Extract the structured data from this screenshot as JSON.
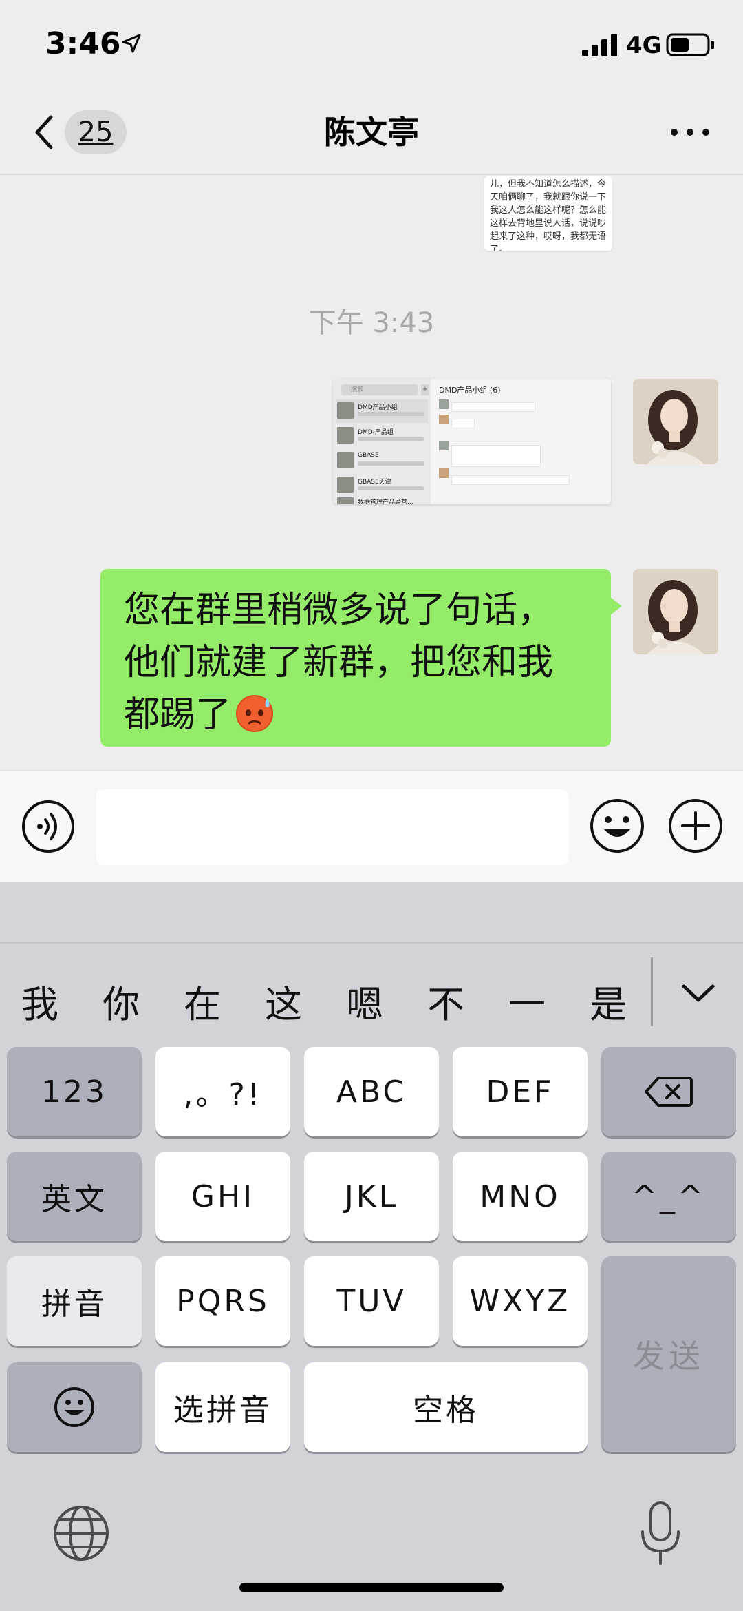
{
  "status_bar": {
    "time": "3:46",
    "network": "4G",
    "location_icon": "location-arrow-icon",
    "signal_icon": "signal-bars-icon",
    "battery_icon": "battery-icon"
  },
  "nav": {
    "back_icon": "chevron-left-icon",
    "unread_count": "25",
    "title": "陈文亭",
    "more_icon": "ellipsis-icon"
  },
  "chat": {
    "prev_image_text": "儿，但我不知道怎么描述，今天咱俩聊了，我就跟你说一下我这人怎么能这样呢？怎么能这样去背地里说人话，说说吵起来了这种，哎呀，我都无语了。",
    "timestamp": "下午 3:43",
    "screenshot": {
      "search_placeholder": "搜索",
      "plus": "+",
      "group_title": "DMD产品小组 (6)",
      "rows": [
        "DMD产品小组",
        "DMD-产品组",
        "GBASE",
        "GBASE天津",
        "数据管理产品经营..."
      ]
    },
    "message_text": "您在群里稍微多说了句话，他们就建了新群，把您和我都踢了",
    "message_emoji": "sweat-face-emoji"
  },
  "input_bar": {
    "voice_icon": "voice-icon",
    "text_value": "",
    "emoji_icon": "smiley-icon",
    "plus_icon": "plus-circle-icon"
  },
  "keyboard": {
    "candidates": [
      "我",
      "你",
      "在",
      "这",
      "嗯",
      "不",
      "一",
      "是"
    ],
    "expand_icon": "chevron-down-icon",
    "keys": {
      "num": "123",
      "punct": ",。?!",
      "abc": "ABC",
      "def": "DEF",
      "delete_icon": "backspace-icon",
      "english": "英文",
      "ghi": "GHI",
      "jkl": "JKL",
      "mno": "MNO",
      "kaomoji": "^_^",
      "pinyin": "拼音",
      "pqrs": "PQRS",
      "tuv": "TUV",
      "wxyz": "WXYZ",
      "send": "发送",
      "emoji_icon": "emoji-face-icon",
      "select_pinyin": "选拼音",
      "space": "空格"
    },
    "globe_icon": "globe-icon",
    "mic_icon": "microphone-icon"
  }
}
